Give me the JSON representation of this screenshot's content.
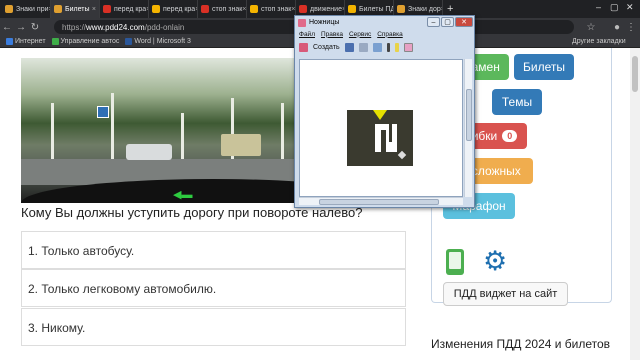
{
  "browser": {
    "tabs": [
      {
        "title": "Знаки при",
        "color": "#e0a030",
        "active": false
      },
      {
        "title": "Билеты",
        "color": "#e0a030",
        "active": true
      },
      {
        "title": "перед кра",
        "color": "#d93025",
        "active": false
      },
      {
        "title": "перед кра",
        "color": "#f4b400",
        "active": false
      },
      {
        "title": "стоп знак",
        "color": "#d93025",
        "active": false
      },
      {
        "title": "стоп знак",
        "color": "#f4b400",
        "active": false
      },
      {
        "title": "движение",
        "color": "#d93025",
        "active": false
      },
      {
        "title": "Билеты ПД",
        "color": "#f4b400",
        "active": false
      },
      {
        "title": "Знаки дор",
        "color": "#e0a030",
        "active": false
      }
    ],
    "new_tab": "+",
    "url_prefix": "https://",
    "url_host": "www.pdd24.com",
    "url_path": "/pdd-onlain",
    "bookmarks": [
      {
        "label": "Интернет",
        "color": "#3b7ddd"
      },
      {
        "label": "Управление автос",
        "color": "#3fae49"
      },
      {
        "label": "Word | Microsoft 3",
        "color": "#2b579a"
      }
    ],
    "other_bookmarks": "Другие закладки"
  },
  "quiz": {
    "question": "Кому Вы должны уступить дорогу при повороте налево?",
    "answers": [
      "1. Только автобусу.",
      "2. Только легковому автомобилю.",
      "3. Никому."
    ]
  },
  "sidebar": {
    "exam_label": "Экзамен",
    "tickets_label": "Билеты",
    "themes_label": "Темы",
    "errors_label": "Ошибки",
    "errors_count": "0",
    "hard_label": "20 сложных",
    "marathon_label": "Марафон",
    "widget_label": "ПДД виджет на сайт",
    "news_title": "Изменения ПДД 2024 и билетов"
  },
  "snipping": {
    "title": "Ножницы",
    "menu": [
      "Файл",
      "Правка",
      "Сервис",
      "Справка"
    ],
    "create_label": "Создать"
  },
  "colors": {
    "exam": "#5cb85c",
    "tickets": "#337ab7",
    "themes": "#337ab7",
    "errors": "#d9534f",
    "hard": "#f0ad4e",
    "marathon": "#5bc0de"
  }
}
